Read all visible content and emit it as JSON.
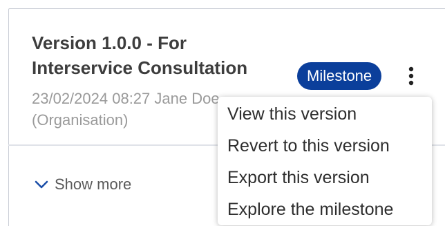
{
  "card": {
    "title": "Version 1.0.0 - For Interservice Consultation",
    "meta": "23/02/2024 08:27 Jane Doe (Organisation)",
    "badge": "Milestone",
    "show_more_label": "Show more"
  },
  "menu": {
    "items": [
      {
        "label": "View this version"
      },
      {
        "label": "Revert to this version"
      },
      {
        "label": "Export this version"
      },
      {
        "label": "Explore the milestone"
      }
    ]
  },
  "icons": {
    "show_more": "chevron-down-icon",
    "menu_toggle": "kebab-menu-icon"
  },
  "colors": {
    "badge_background": "#0b3f9b",
    "badge_text": "#ffffff",
    "title_text": "#3d3d3d",
    "meta_text": "#9a9a9a"
  }
}
